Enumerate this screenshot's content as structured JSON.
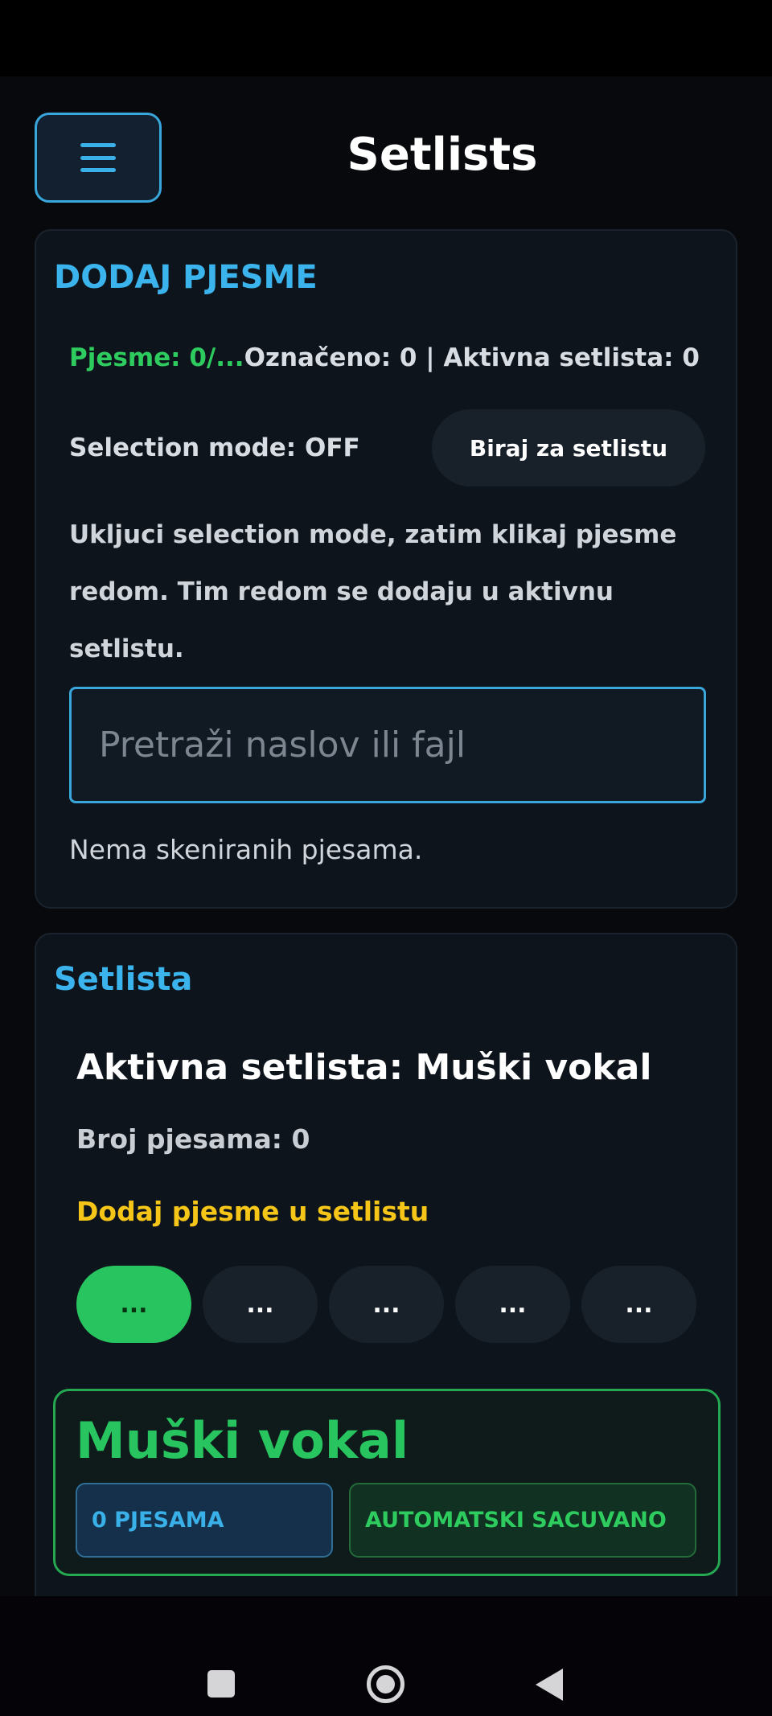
{
  "header": {
    "title": "Setlists",
    "menu_icon": "hamburger-menu-icon"
  },
  "add_songs": {
    "heading": "DODAJ PJESME",
    "songs_stat": "Pjesme: 0/...",
    "stats_rest": "Označeno: 0 | Aktivna setlista: 0",
    "selection_mode_label": "Selection mode: OFF",
    "pick_button": "Biraj za setlistu",
    "hint": "Ukljuci selection mode, zatim klikaj pjesme redom. Tim redom se dodaju u aktivnu setlistu.",
    "search_placeholder": "Pretraži naslov ili fajl",
    "search_value": "",
    "empty_note": "Nema skeniranih pjesama."
  },
  "setlist": {
    "heading": "Setlista",
    "active_title": "Aktivna setlista: Muški vokal",
    "count_label": "Broj pjesama: 0",
    "add_prompt": "Dodaj pjesme u setlistu",
    "pills": [
      "...",
      "...",
      "...",
      "...",
      "..."
    ],
    "card": {
      "name": "Muški vokal",
      "count_chip": "0 PJESAMA",
      "saved_chip": "AUTOMATSKI SACUVANO"
    }
  },
  "colors": {
    "accent_blue": "#3bb3ec",
    "accent_green": "#27c45f",
    "accent_yellow": "#f5c518",
    "background": "#07090c"
  },
  "system_nav": {
    "recent_icon": "recent-apps-icon",
    "home_icon": "home-icon",
    "back_icon": "back-icon"
  }
}
